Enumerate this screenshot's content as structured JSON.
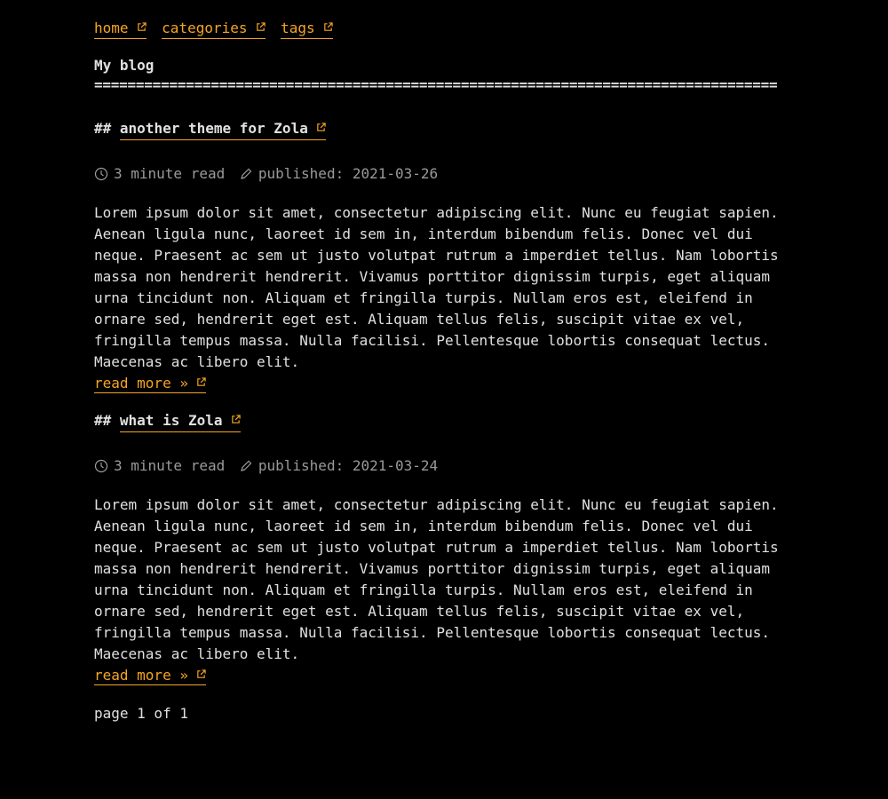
{
  "nav": {
    "items": [
      {
        "label": "home"
      },
      {
        "label": "categories"
      },
      {
        "label": "tags"
      }
    ]
  },
  "site": {
    "title": "My blog",
    "rule": "=================================================================================="
  },
  "posts": [
    {
      "hash": "##",
      "title": "another theme for Zola",
      "read_time": "3 minute read",
      "published": "published: 2021-03-26",
      "excerpt": "Lorem ipsum dolor sit amet, consectetur adipiscing elit. Nunc eu feugiat sapien. Aenean ligula nunc, laoreet id sem in, interdum bibendum felis. Donec vel dui neque. Praesent ac sem ut justo volutpat rutrum a imperdiet tellus. Nam lobortis massa non hendrerit hendrerit. Vivamus porttitor dignissim turpis, eget aliquam urna tincidunt non. Aliquam et fringilla turpis. Nullam eros est, eleifend in ornare sed, hendrerit eget est. Aliquam tellus felis, suscipit vitae ex vel, fringilla tempus massa. Nulla facilisi. Pellentesque lobortis consequat lectus. Maecenas ac libero elit.",
      "read_more": "read more »"
    },
    {
      "hash": "##",
      "title": "what is Zola",
      "read_time": "3 minute read",
      "published": "published: 2021-03-24",
      "excerpt": "Lorem ipsum dolor sit amet, consectetur adipiscing elit. Nunc eu feugiat sapien. Aenean ligula nunc, laoreet id sem in, interdum bibendum felis. Donec vel dui neque. Praesent ac sem ut justo volutpat rutrum a imperdiet tellus. Nam lobortis massa non hendrerit hendrerit. Vivamus porttitor dignissim turpis, eget aliquam urna tincidunt non. Aliquam et fringilla turpis. Nullam eros est, eleifend in ornare sed, hendrerit eget est. Aliquam tellus felis, suscipit vitae ex vel, fringilla tempus massa. Nulla facilisi. Pellentesque lobortis consequat lectus. Maecenas ac libero elit.",
      "read_more": "read more »"
    }
  ],
  "pagination": {
    "label": "page 1 of 1"
  },
  "icons": {
    "external_link": "external-link-icon",
    "clock": "clock-icon",
    "pencil": "pencil-icon"
  },
  "colors": {
    "background": "#000000",
    "text": "#e0e0e0",
    "muted": "#9a9a9a",
    "accent": "#f5a524"
  }
}
